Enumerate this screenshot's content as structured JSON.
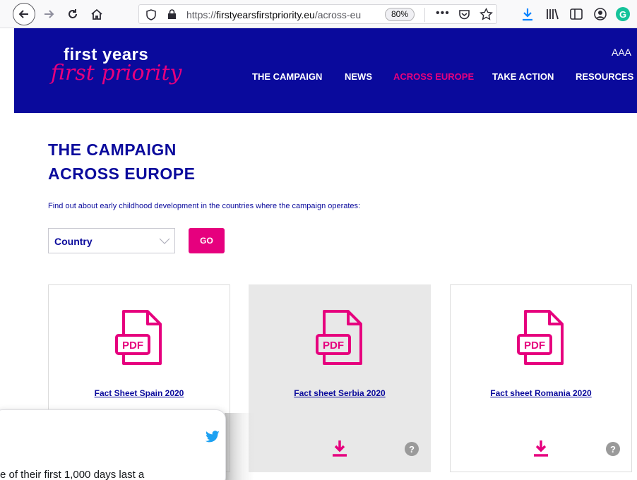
{
  "browser": {
    "url_prefix": "https://",
    "url_host": "firstyearsfirstpriority.eu",
    "url_path": "/across-eu",
    "zoom": "80%"
  },
  "header": {
    "logo_line1": "first years",
    "logo_line2": "first priority",
    "text_size_toggle": "AAA",
    "nav": [
      "THE CAMPAIGN",
      "NEWS",
      "ACROSS EUROPE",
      "TAKE ACTION",
      "RESOURCES"
    ],
    "active_nav": "ACROSS EUROPE"
  },
  "main": {
    "title_line1": "THE CAMPAIGN",
    "title_line2": "ACROSS EUROPE",
    "intro": "Find out about early childhood development in the countries where the campaign operates:",
    "country_select": "Country",
    "go_label": "GO"
  },
  "cards": [
    {
      "title": "Fact Sheet Spain 2020",
      "pdf_label": "PDF"
    },
    {
      "title": "Fact sheet Serbia 2020",
      "pdf_label": "PDF"
    },
    {
      "title": "Fact sheet Romania 2020",
      "pdf_label": "PDF"
    }
  ],
  "tweet": {
    "text_fragment": "e of their first 1,000 days last a"
  },
  "colors": {
    "brand_blue": "#0a0a9c",
    "brand_pink": "#e6007e",
    "twitter_blue": "#1da1f2"
  }
}
